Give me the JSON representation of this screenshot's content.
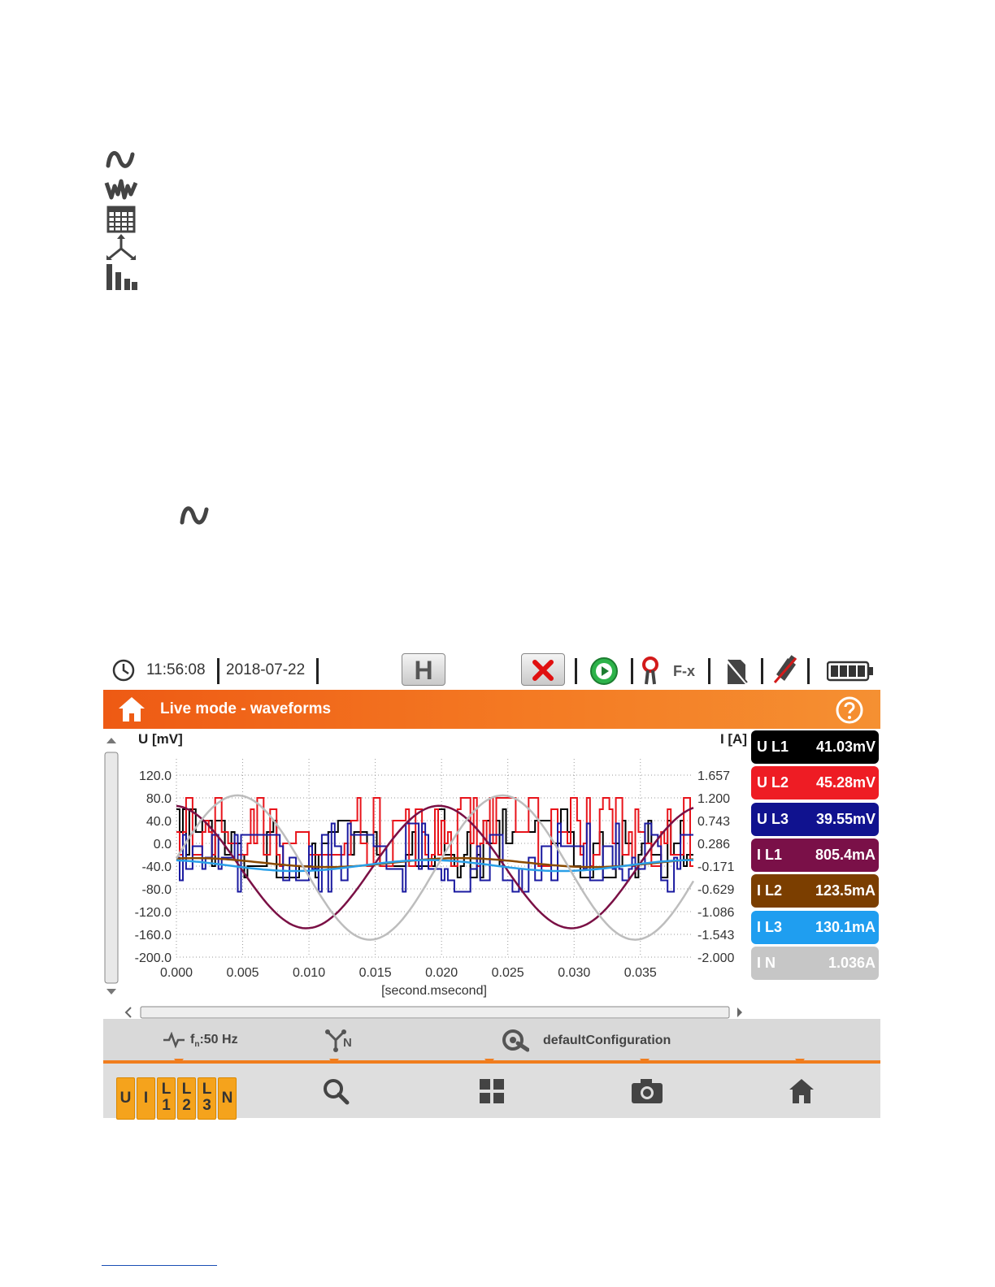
{
  "page_icons": [
    "sine-wave-icon",
    "distorted-wave-icon",
    "table-grid-icon",
    "phasor-diagram-icon",
    "bar-chart-icon",
    "sine-wave-icon"
  ],
  "status": {
    "time": "11:56:08",
    "date": "2018-07-22",
    "hold_label": "H",
    "clamp_label": "F-x"
  },
  "title": "Live mode - waveforms",
  "chart_data": {
    "type": "line",
    "ylabel_left": "U [mV]",
    "ylabel_right": "I [A]",
    "xlabel": "[second.msecond]",
    "x_ticks": [
      "0.000",
      "0.005",
      "0.010",
      "0.015",
      "0.020",
      "0.025",
      "0.030",
      "0.035"
    ],
    "y_left_ticks": [
      "120.0",
      "80.0",
      "40.0",
      "0.0",
      "-40.0",
      "-80.0",
      "-120.0",
      "-160.0",
      "-200.0"
    ],
    "y_right_ticks": [
      "1.657",
      "1.200",
      "0.743",
      "0.286",
      "-0.171",
      "-0.629",
      "-1.086",
      "-1.543",
      "-2.000"
    ],
    "x_range": [
      0.0,
      0.039
    ],
    "y_left_range": [
      -200.0,
      120.0
    ],
    "y_right_range": [
      -2.0,
      1.657
    ],
    "grid": true,
    "series": [
      {
        "name": "U L1",
        "color": "#000000",
        "axis": "left",
        "kind": "noise",
        "base": 0,
        "amp": 60,
        "seed": 3
      },
      {
        "name": "U L2",
        "color": "#e8141b",
        "axis": "left",
        "kind": "noise",
        "base": 20,
        "amp": 70,
        "seed": 7
      },
      {
        "name": "U L3",
        "color": "#1a1aa0",
        "axis": "left",
        "kind": "noise",
        "base": -25,
        "amp": 60,
        "seed": 11
      },
      {
        "name": "I L1",
        "color": "#7a1045",
        "axis": "right",
        "kind": "sine",
        "amplitude": 1.23,
        "offset": -0.19,
        "phase": 0.26
      },
      {
        "name": "I L2",
        "color": "#8a4a00",
        "axis": "right",
        "kind": "sine",
        "amplitude": 0.09,
        "offset": -0.1,
        "phase": 0.18
      },
      {
        "name": "I L3",
        "color": "#2aa0e8",
        "axis": "right",
        "kind": "sine",
        "amplitude": 0.11,
        "offset": -0.16,
        "phase": 0.3
      },
      {
        "name": "I N",
        "color": "#bdbdbd",
        "axis": "right",
        "kind": "sine",
        "amplitude": 1.45,
        "offset": -0.2,
        "phase": 0.02
      }
    ]
  },
  "legend": [
    {
      "label": "U L1",
      "value": "41.03mV",
      "bg": "#000000"
    },
    {
      "label": "U L2",
      "value": "45.28mV",
      "bg": "#ee1c24"
    },
    {
      "label": "U L3",
      "value": "39.55mV",
      "bg": "#10128f"
    },
    {
      "label": "I L1",
      "value": "805.4mA",
      "bg": "#7a1048"
    },
    {
      "label": "I L2",
      "value": "123.5mA",
      "bg": "#7b3e00"
    },
    {
      "label": "I L3",
      "value": "130.1mA",
      "bg": "#1f9ef0"
    },
    {
      "label": "I N",
      "value": "1.036A",
      "bg": "#c6c6c6"
    }
  ],
  "info": {
    "freq_prefix": "f",
    "freq_sub": "n",
    "freq_value": ":50 Hz",
    "network_sub": "N",
    "config": "defaultConfiguration"
  },
  "toolbar": {
    "u_label": "U",
    "i_label": "I",
    "l1_top": "L",
    "l1_bottom": "1",
    "l2_top": "L",
    "l2_bottom": "2",
    "l3_top": "L",
    "l3_bottom": "3",
    "n_label": "N"
  },
  "colors": {
    "accent": "#f07d1e",
    "title_bar": "#ee5a14",
    "toolbar_button": "#f5a31c"
  }
}
